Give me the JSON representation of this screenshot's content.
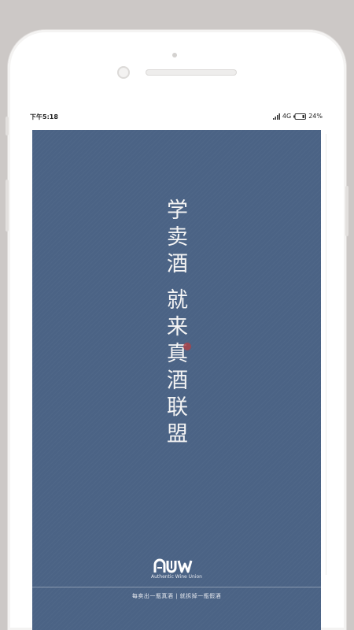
{
  "status": {
    "time": "下午5:18",
    "network": "4G",
    "battery": "24%"
  },
  "splash": {
    "slogan_line1": "学卖酒",
    "slogan_line2": "就来真酒联盟",
    "logo_mark": "AWU",
    "logo_subtitle": "Authentic Wine Union",
    "tagline": "每卖出一瓶真酒 | 就拆掉一瓶假酒"
  },
  "colors": {
    "background": "#ccc8c6",
    "screen": "#4b6385",
    "seal": "#a9434a"
  },
  "icons": [
    "signal-icon",
    "battery-icon",
    "seal-icon"
  ]
}
